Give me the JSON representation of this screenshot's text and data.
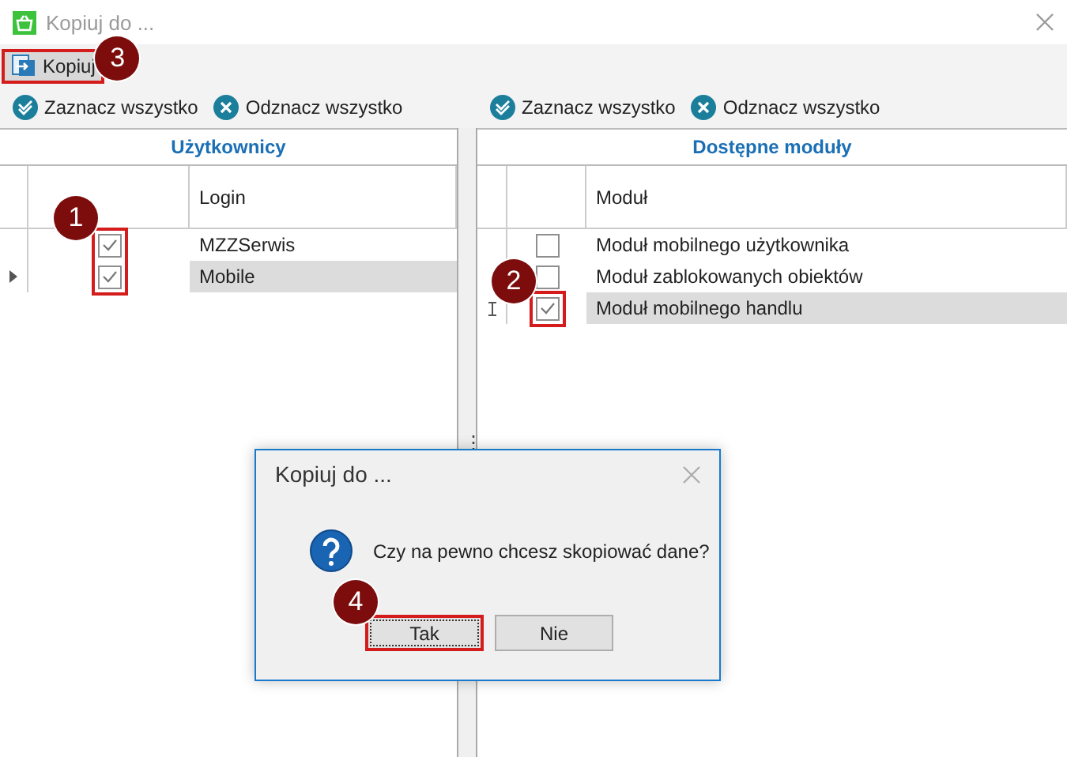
{
  "window": {
    "title": "Kopiuj do ...",
    "active": false
  },
  "toolbar": {
    "button": {
      "label": "Kopiuj",
      "highlighted": true,
      "callout": "3"
    }
  },
  "panels": [
    {
      "actions": [
        {
          "label": "Zaznacz wszystko",
          "kind": "check"
        },
        {
          "label": "Odznacz wszystko",
          "kind": "uncheck"
        }
      ],
      "title": "Użytkownicy",
      "column": "Login",
      "callout": "1",
      "rows": [
        {
          "text": "MZZSerwis",
          "checked": true,
          "selected": false,
          "current": false,
          "editing": false,
          "highlighted": true
        },
        {
          "text": "Mobile",
          "checked": true,
          "selected": true,
          "current": true,
          "editing": false,
          "highlighted": true
        }
      ]
    },
    {
      "actions": [
        {
          "label": "Zaznacz wszystko",
          "kind": "check"
        },
        {
          "label": "Odznacz wszystko",
          "kind": "uncheck"
        }
      ],
      "title": "Dostępne moduły",
      "column": "Moduł",
      "callout": "2",
      "rows": [
        {
          "text": "Moduł mobilnego użytkownika",
          "checked": false,
          "selected": false,
          "current": false,
          "editing": false,
          "highlighted": false
        },
        {
          "text": "Moduł zablokowanych obiektów",
          "checked": false,
          "selected": false,
          "current": false,
          "editing": false,
          "highlighted": false
        },
        {
          "text": "Moduł mobilnego handlu",
          "checked": true,
          "selected": true,
          "current": false,
          "editing": true,
          "highlighted": true
        }
      ]
    }
  ],
  "splitter": {
    "grip": "⋮"
  },
  "dialog": {
    "title": "Kopiuj do ...",
    "message": "Czy na pewno chcesz skopiować dane?",
    "buttons": [
      {
        "label": "Tak",
        "focused": true,
        "highlighted": true,
        "callout": "4"
      },
      {
        "label": "Nie",
        "focused": false,
        "highlighted": false
      }
    ]
  }
}
